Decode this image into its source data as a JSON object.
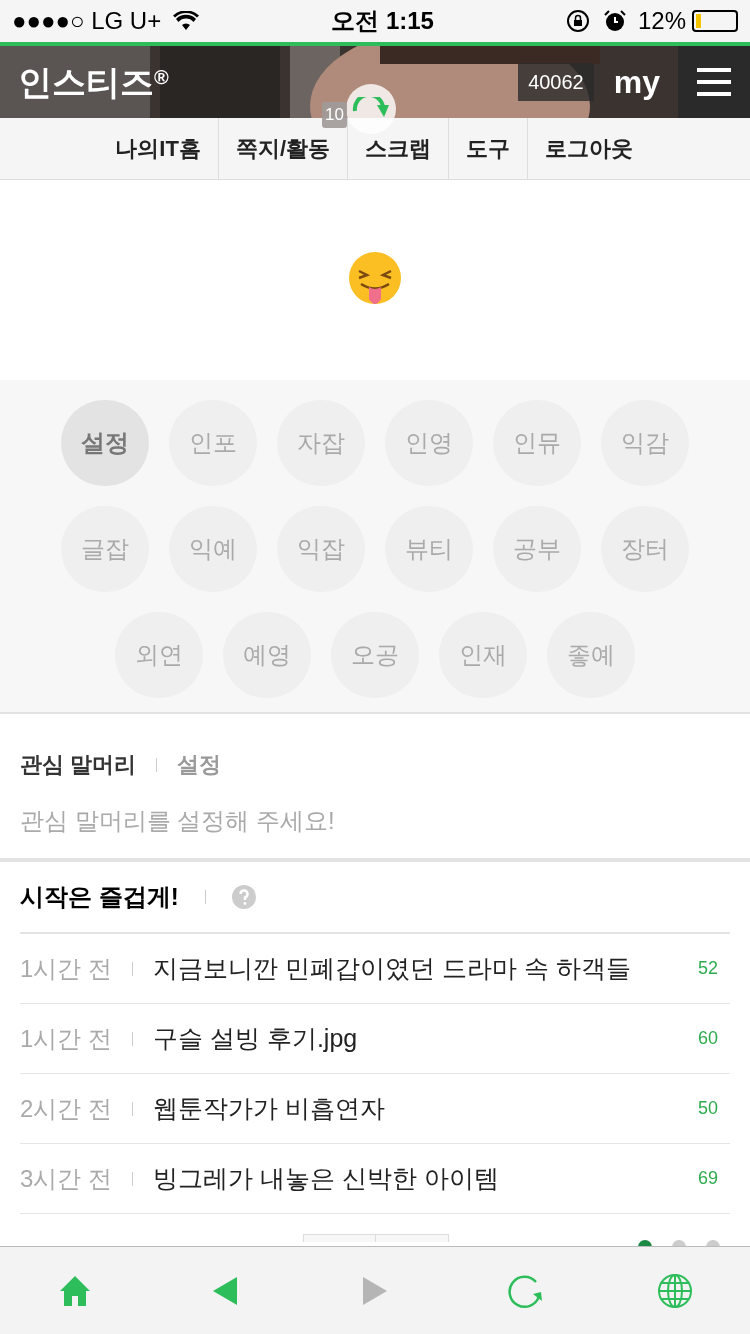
{
  "status_bar": {
    "carrier": "●●●●○ LG U+",
    "time": "오전 1:15",
    "battery": "12%"
  },
  "header": {
    "logo": "인스티즈",
    "logo_mark": "®",
    "count": "40062",
    "my": "my"
  },
  "nav": [
    {
      "label": "나의IT홈"
    },
    {
      "label": "쪽지/활동"
    },
    {
      "label": "스크랩"
    },
    {
      "label": "도구"
    },
    {
      "label": "로그아웃"
    }
  ],
  "scrap_badge": "10",
  "categories": [
    {
      "label": "설정",
      "selected": true
    },
    {
      "label": "인포",
      "selected": false
    },
    {
      "label": "자잡",
      "selected": false
    },
    {
      "label": "인영",
      "selected": false
    },
    {
      "label": "인뮤",
      "selected": false
    },
    {
      "label": "익감",
      "selected": false
    },
    {
      "label": "글잡",
      "selected": false
    },
    {
      "label": "익예",
      "selected": false
    },
    {
      "label": "익잡",
      "selected": false
    },
    {
      "label": "뷰티",
      "selected": false
    },
    {
      "label": "공부",
      "selected": false
    },
    {
      "label": "장터",
      "selected": false
    },
    {
      "label": "외연",
      "selected": false
    },
    {
      "label": "예영",
      "selected": false
    },
    {
      "label": "오공",
      "selected": false
    },
    {
      "label": "인재",
      "selected": false
    },
    {
      "label": "좋예",
      "selected": false
    }
  ],
  "interest": {
    "title": "관심 말머리",
    "link": "설정",
    "hint": "관심 말머리를 설정해 주세요!"
  },
  "feed": {
    "title": "시작은 즐겁게!",
    "posts": [
      {
        "time": "1시간 전",
        "title": "지금보니깐 민폐갑이였던 드라마 속 하객들",
        "count": "52"
      },
      {
        "time": "1시간 전",
        "title": "구슬 설빙 후기.jpg",
        "count": "60"
      },
      {
        "time": "2시간 전",
        "title": "웹툰작가가 비흡연자",
        "count": "50"
      },
      {
        "time": "3시간 전",
        "title": "빙그레가 내놓은 신박한 아이템",
        "count": "69"
      }
    ],
    "pager_dots": [
      {
        "selected": true
      },
      {
        "selected": false
      },
      {
        "selected": false
      }
    ]
  },
  "toolbar": [
    {
      "kind": "home",
      "disabled": false
    },
    {
      "kind": "back",
      "disabled": false
    },
    {
      "kind": "forward",
      "disabled": true
    },
    {
      "kind": "reload",
      "disabled": false
    },
    {
      "kind": "globe",
      "disabled": false
    }
  ]
}
